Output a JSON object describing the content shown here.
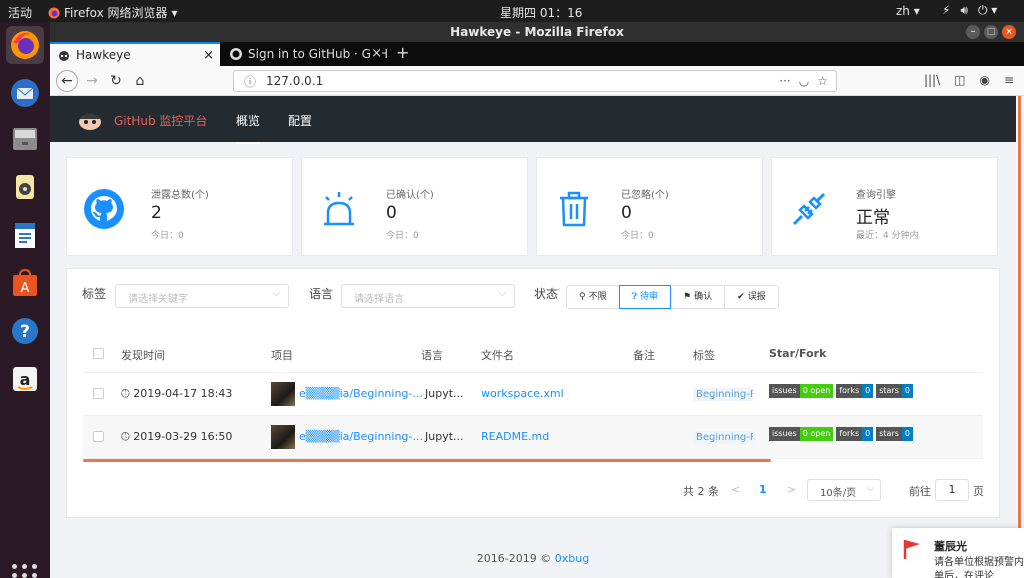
{
  "system": {
    "activities": "活动",
    "app_menu": "Firefox 网络浏览器",
    "clock": "星期四 01：16",
    "lang": "zh"
  },
  "window": {
    "title": "Hawkeye - Mozilla Firefox"
  },
  "tabs": [
    {
      "label": "Hawkeye",
      "active": true
    },
    {
      "label": "Sign in to GitHub · GitHub",
      "active": false
    }
  ],
  "urlbar": {
    "url": "127.0.0.1"
  },
  "app": {
    "brand": "GitHub 监控平台",
    "nav": [
      "概览",
      "配置"
    ]
  },
  "cards": [
    {
      "label": "泄露总数(个)",
      "value": "2",
      "sub": "今日：0",
      "icon": "github-icon"
    },
    {
      "label": "已确认(个)",
      "value": "0",
      "sub": "今日：0",
      "icon": "alarm-icon"
    },
    {
      "label": "已忽略(个)",
      "value": "0",
      "sub": "今日：0",
      "icon": "trash-icon"
    },
    {
      "label": "查询引擎",
      "value": "正常",
      "sub": "最近：4 分钟内",
      "icon": "plug-icon"
    }
  ],
  "filters": {
    "tag_label": "标签",
    "tag_placeholder": "请选择关键字",
    "lang_label": "语言",
    "lang_placeholder": "请选择语言",
    "status_label": "状态",
    "status_options": [
      "不限",
      "待审",
      "确认",
      "误报"
    ],
    "status_selected": "待审"
  },
  "table": {
    "headers": [
      "发现时间",
      "项目",
      "语言",
      "文件名",
      "备注",
      "标签",
      "Star/Fork"
    ],
    "rows": [
      {
        "time": "2019-04-17 18:43",
        "project": "e▒▒▒▒ia/Beginning-...",
        "language": "Jupyt...",
        "filename": "workspace.xml",
        "note": "",
        "tag": "Beginning-Pyth",
        "issues_label": "issues",
        "issues": "0 open",
        "forks_label": "forks",
        "forks": "0",
        "stars_label": "stars",
        "stars": "0"
      },
      {
        "time": "2019-03-29 16:50",
        "project": "e▒▒▒▒ia/Beginning-...",
        "language": "Jupyt...",
        "filename": "README.md",
        "note": "",
        "tag": "Beginning-Pyth",
        "issues_label": "issues",
        "issues": "0 open",
        "forks_label": "forks",
        "forks": "0",
        "stars_label": "stars",
        "stars": "0"
      }
    ]
  },
  "pagination": {
    "total": "共 2 条",
    "prev": "<",
    "current": "1",
    "next": ">",
    "page_size": "10条/页",
    "goto_label": "前往",
    "goto_value": "1",
    "page_suffix": "页"
  },
  "footer": {
    "text": "2016-2019 ©",
    "link": "0xbug"
  },
  "notification": {
    "title": "董辰光",
    "body": "请各单位根据预警内容预警单后，在评论"
  },
  "colors": {
    "accent": "#1890ff",
    "brand": "#e95f5c",
    "header_bg": "#232a30",
    "ubuntu_orange": "#e95420"
  }
}
